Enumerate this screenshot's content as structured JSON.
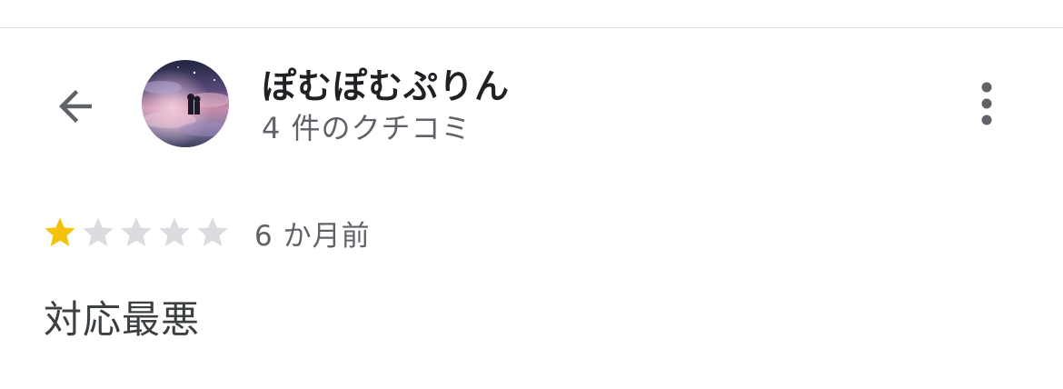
{
  "header": {
    "back_icon": "arrow-left-icon",
    "more_icon": "more-vert-icon"
  },
  "reviewer": {
    "name": "ぽむぽむぷりん",
    "review_count": "4 件のクチコミ",
    "avatar": "profile-photo"
  },
  "review": {
    "rating": 1,
    "max_rating": 5,
    "time": "6 か月前",
    "text": "対応最悪"
  },
  "colors": {
    "star_filled": "#f4c20d",
    "star_empty": "#dadce0",
    "icon": "#5f6368",
    "divider": "#dadce0"
  }
}
